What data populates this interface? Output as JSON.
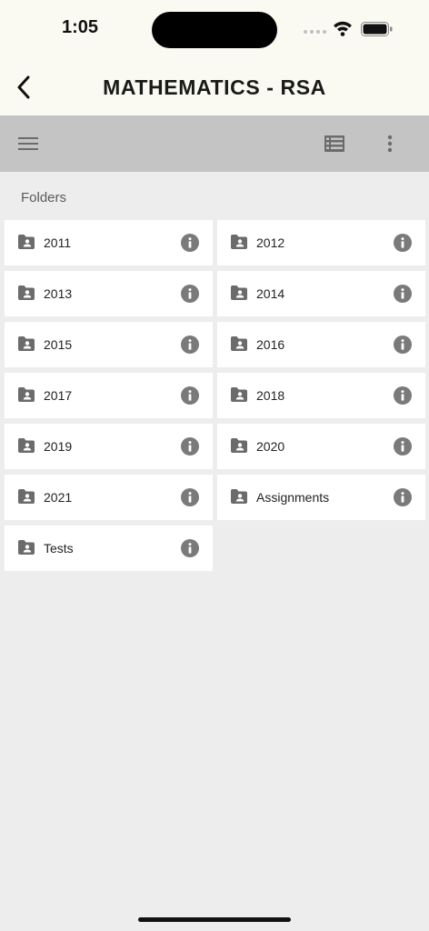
{
  "status_bar": {
    "time": "1:05"
  },
  "header": {
    "title": "MATHEMATICS - RSA"
  },
  "section": {
    "label": "Folders"
  },
  "folders": [
    {
      "name": "2011"
    },
    {
      "name": "2012"
    },
    {
      "name": "2013"
    },
    {
      "name": "2014"
    },
    {
      "name": "2015"
    },
    {
      "name": "2016"
    },
    {
      "name": "2017"
    },
    {
      "name": "2018"
    },
    {
      "name": "2019"
    },
    {
      "name": "2020"
    },
    {
      "name": "2021"
    },
    {
      "name": "Assignments"
    },
    {
      "name": "Tests"
    }
  ],
  "icons": {
    "back": "chevron-left-icon",
    "menu": "hamburger-menu-icon",
    "list_view": "list-view-icon",
    "more": "more-vertical-icon",
    "folder": "shared-folder-icon",
    "info": "info-icon"
  },
  "colors": {
    "header_bg": "#fafaf2",
    "toolbar_bg": "#c4c4c4",
    "page_bg": "#ededed",
    "icon_gray": "#6b6b6b"
  }
}
